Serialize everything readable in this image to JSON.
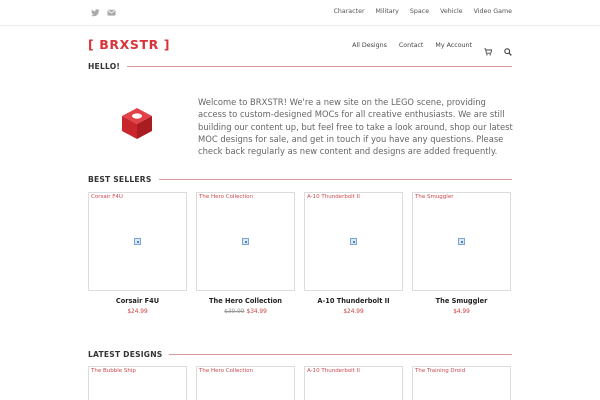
{
  "topbar": {
    "social_icons": [
      "twitter-icon",
      "email-icon"
    ],
    "nav": [
      "Character",
      "Military",
      "Space",
      "Vehicle",
      "Video Game"
    ]
  },
  "header": {
    "logo": "[ BRXSTR ]",
    "nav": {
      "all_designs": "All Designs",
      "contact": "Contact",
      "account": "My Account"
    },
    "icons": [
      "cart-icon",
      "search-icon"
    ]
  },
  "colors": {
    "brand_red": "#d9343a",
    "rule": "#d89a9d"
  },
  "hello": {
    "heading": "HELLO!",
    "icon": "lego-brick-icon",
    "text": "Welcome to BRXSTR! We're a new site on the LEGO scene, providing access to custom-designed MOCs for all creative enthusiasts. We are still building our content up, but feel free to take a look around, shop our latest MOC designs for sale, and get in touch if you have any questions. Please check back regularly as new content and designs are added frequently."
  },
  "best_sellers": {
    "heading": "BEST SELLERS",
    "items": [
      {
        "alt": "Corsair F4U",
        "title": "Corsair F4U",
        "price": "$24.99",
        "old_price": ""
      },
      {
        "alt": "The Hero Collection",
        "title": "The Hero Collection",
        "price": "$34.99",
        "old_price": "$39.99"
      },
      {
        "alt": "A-10 Thunderbolt II",
        "title": "A-10 Thunderbolt II",
        "price": "$24.99",
        "old_price": ""
      },
      {
        "alt": "The Smuggler",
        "title": "The Smuggler",
        "price": "$4.99",
        "old_price": ""
      }
    ]
  },
  "latest_designs": {
    "heading": "LATEST DESIGNS",
    "items": [
      {
        "alt": "The Bubble Ship"
      },
      {
        "alt": "The Hero Collection"
      },
      {
        "alt": "A-10 Thunderbolt II"
      },
      {
        "alt": "The Training Droid"
      }
    ]
  }
}
